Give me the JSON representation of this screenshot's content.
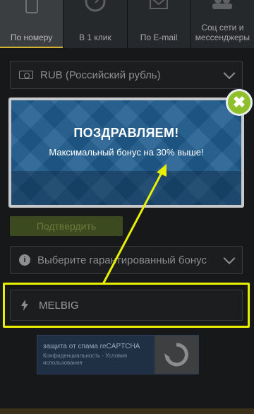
{
  "tabs": [
    {
      "label": "По номеру",
      "icon": "phone-icon",
      "active": true
    },
    {
      "label": "В 1 клик",
      "icon": "speedometer-icon",
      "active": false
    },
    {
      "label": "По E-mail",
      "icon": "envelope-icon",
      "active": false
    },
    {
      "label": "Соц сети и мессенджеры",
      "icon": "users-icon",
      "active": false
    }
  ],
  "currency": {
    "value": "RUB (Российский рубль)",
    "icon": "currency-icon"
  },
  "confirm_label": "Подтвердить",
  "bonus": {
    "placeholder": "Выберите гарантированный бонус",
    "icon": "info-icon"
  },
  "promo": {
    "value": "MELBIG",
    "icon": "lightning-icon"
  },
  "captcha": {
    "title": "защита от спама reCAPTCHA",
    "links": "Конфиденциальность - Условия использования",
    "icon": "recaptcha-icon"
  },
  "popup": {
    "title": "ПОЗДРАВЛЯЕМ!",
    "subtitle": "Максимальный бонус на 30% выше!",
    "close_icon": "close-icon"
  },
  "colors": {
    "background": "#16181a",
    "accent": "#d4b033",
    "popup_blue": "#1f5c8e",
    "highlight": "#e8f000",
    "close_green": "#8fbf2a"
  }
}
